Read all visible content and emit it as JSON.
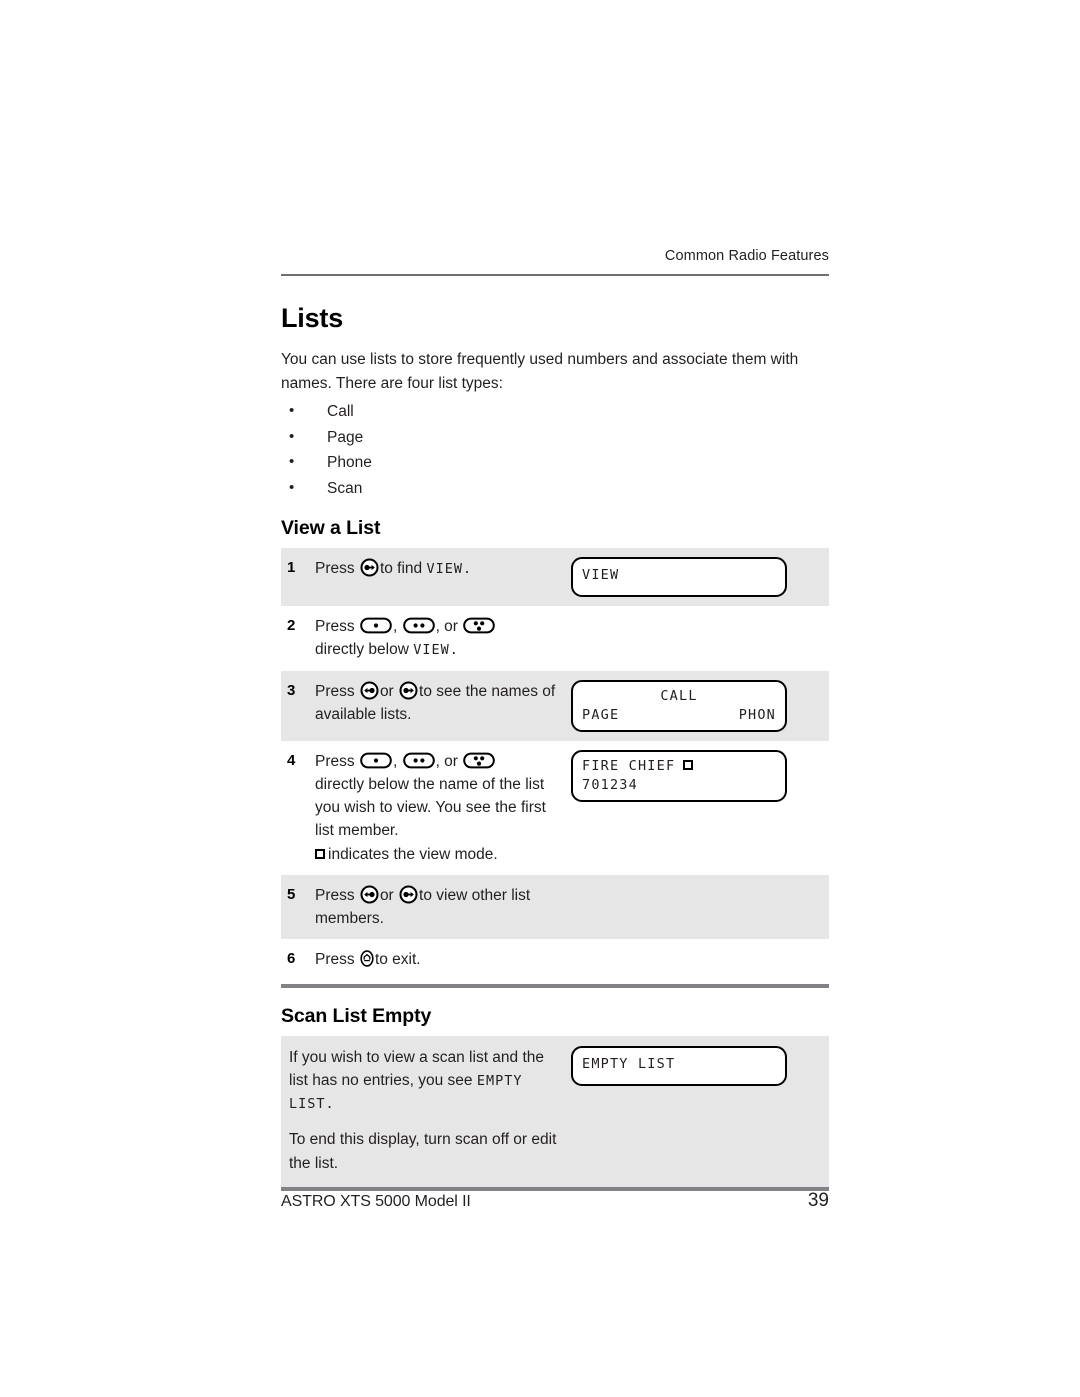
{
  "header": {
    "running_head": "Common Radio Features"
  },
  "chapter": {
    "title": "Lists",
    "intro": "You can use lists to store frequently used numbers and associate them with names. There are four list types:",
    "list_types": [
      "Call",
      "Page",
      "Phone",
      "Scan"
    ]
  },
  "view_a_list": {
    "title": "View a List",
    "steps": [
      {
        "number": "1",
        "text_before": "Press",
        "icon": "dot-right-arrow-button",
        "text_middle": "to find",
        "mono_term": "VIEW",
        "text_after": ".",
        "shaded": true,
        "display": {
          "lines": [
            "VIEW"
          ],
          "type": "single-line"
        }
      },
      {
        "number": "2",
        "text_before": "Press",
        "icons": [
          "one-dot-button",
          "two-dot-button",
          "three-dot-button"
        ],
        "separator_1": ",",
        "separator_2": ", or",
        "text_after": "directly below",
        "mono_term": "VIEW",
        "text_end": ".",
        "shaded": false,
        "display": null
      },
      {
        "number": "3",
        "text_before": "Press",
        "icon_left": "left-arrow-dot-button",
        "text_or": "or",
        "icon_right": "dot-right-arrow-button",
        "text_after": "to see the names of available lists.",
        "shaded": true,
        "display": {
          "type": "two-line",
          "line1_center": "CALL",
          "line2_left": "PAGE",
          "line2_right": "PHON"
        }
      },
      {
        "number": "4",
        "text_before": "Press",
        "icons": [
          "one-dot-button",
          "two-dot-button",
          "three-dot-button"
        ],
        "separator_1": ",",
        "separator_2": ", or",
        "text_after": "directly below the name of the list you wish to view. You see the first list member.",
        "note_icon": "square-indicator-icon",
        "note_text": "indicates the view mode.",
        "shaded": false,
        "display": {
          "type": "two-line-left",
          "line1": "FIRE CHIEF",
          "line1_icon": "square-indicator-icon",
          "line2": "701234"
        }
      },
      {
        "number": "5",
        "text_before": "Press",
        "icon_left": "left-arrow-dot-button",
        "text_or": "or",
        "icon_right": "dot-right-arrow-button",
        "text_after": "to view other list members.",
        "shaded": true,
        "display": null
      },
      {
        "number": "6",
        "text_before": "Press",
        "icon": "home-exit-button",
        "text_after": "to exit.",
        "shaded": false,
        "display": null
      }
    ]
  },
  "scan_list_empty": {
    "title": "Scan List Empty",
    "paragraph_1_part_1": "If you wish to view a scan list and the list has no entries, you see",
    "paragraph_1_mono": "EMPTY LIST",
    "paragraph_1_part_2": ".",
    "paragraph_2": "To end this display, turn scan off or edit the list.",
    "display": {
      "lines": [
        "EMPTY LIST"
      ],
      "type": "single-line"
    }
  },
  "footer": {
    "model": "ASTRO XTS 5000 Model II",
    "page_number": "39"
  },
  "colors": {
    "shade": "#e6e6e6",
    "rule_thin": "#6d6e71",
    "rule_thick": "#808285",
    "text": "#231f20"
  }
}
